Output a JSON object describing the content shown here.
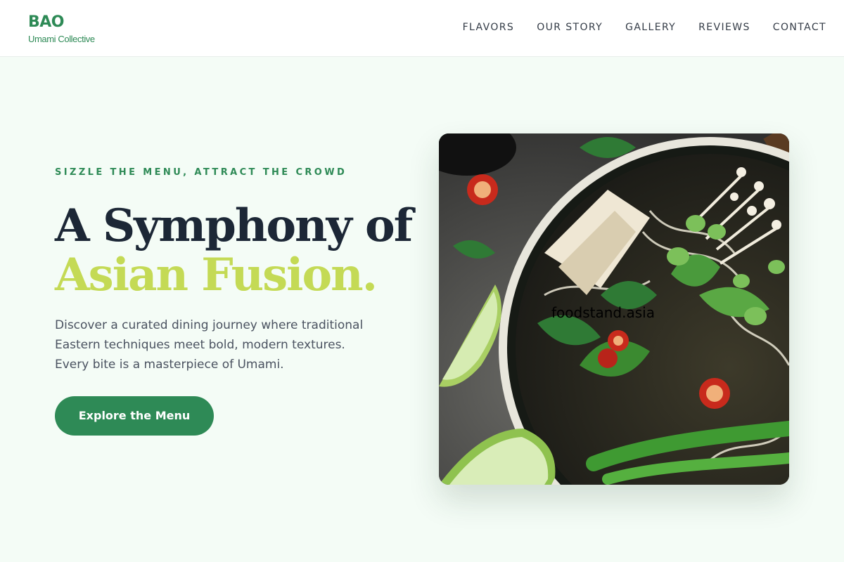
{
  "brand": {
    "name": "BAO",
    "subtitle": "Umami Collective",
    "accent": "#2e8a56"
  },
  "nav": {
    "items": [
      "FLAVORS",
      "OUR STORY",
      "GALLERY",
      "REVIEWS",
      "CONTACT"
    ]
  },
  "hero": {
    "tagline": "SIZZLE THE MENU, ATTRACT THE CROWD",
    "title_line1": "A Symphony of",
    "title_line2": "Asian Fusion.",
    "description": "Discover a curated dining journey where traditional Eastern techniques meet bold, modern textures. Every bite is a masterpiece of Umami.",
    "cta_label": "Explore the Menu",
    "highlight_color": "#c4da55"
  },
  "image": {
    "subject": "bowl of pho with herbs, chili, lime and edamame",
    "watermark": "foodstand.asia"
  }
}
